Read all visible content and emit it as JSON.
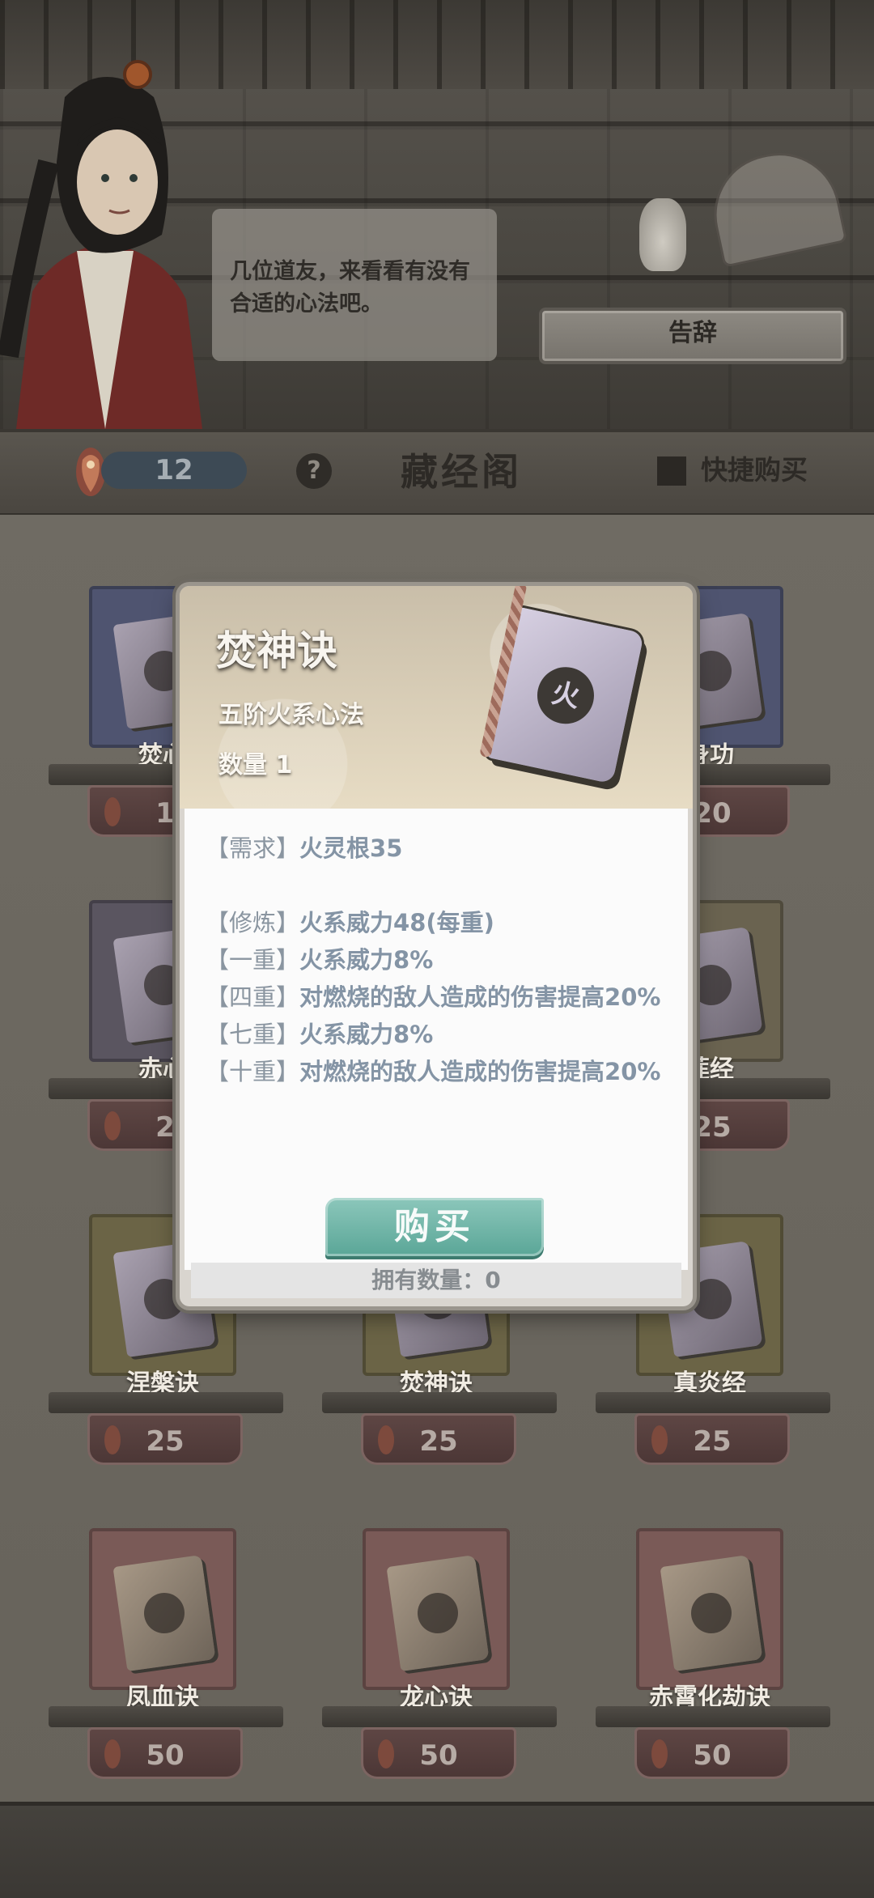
{
  "npc": {
    "speech": "几位道友，来看看有没有合适的心法吧。",
    "farewell_label": "告辞"
  },
  "header": {
    "currency_count": "12",
    "help_label": "?",
    "title": "藏经阁",
    "quick_buy_label": "快捷购买"
  },
  "shelf": {
    "rows": [
      {
        "items": [
          {
            "name": "焚心",
            "price": "1"
          },
          {
            "name": "",
            "price": ""
          },
          {
            "name": "身功",
            "price": "20"
          }
        ]
      },
      {
        "items": [
          {
            "name": "赤心",
            "price": "2"
          },
          {
            "name": "",
            "price": ""
          },
          {
            "name": "莲经",
            "price": "25"
          }
        ]
      },
      {
        "items": [
          {
            "name": "涅槃诀",
            "price": "25"
          },
          {
            "name": "焚神诀",
            "price": "25"
          },
          {
            "name": "真炎经",
            "price": "25"
          }
        ]
      },
      {
        "items": [
          {
            "name": "凤血诀",
            "price": "50"
          },
          {
            "name": "龙心诀",
            "price": "50"
          },
          {
            "name": "赤霄化劫诀",
            "price": "50"
          }
        ]
      }
    ]
  },
  "modal": {
    "skill_name": "焚神诀",
    "skill_type": "五阶火系心法",
    "quantity": "数量 1",
    "book_glyph": "火",
    "description_lines": [
      {
        "tag": "【需求】",
        "text": "火灵根35"
      },
      {
        "tag": "",
        "text": ""
      },
      {
        "tag": "【修炼】",
        "text": "火系威力48(每重)"
      },
      {
        "tag": "【一重】",
        "text": "火系威力8%"
      },
      {
        "tag": "【四重】",
        "text": "对燃烧的敌人造成的伤害提高20%"
      },
      {
        "tag": "【七重】",
        "text": "火系威力8%"
      },
      {
        "tag": "【十重】",
        "text": "对燃烧的敌人造成的伤害提高20%"
      }
    ],
    "buy_label": "购买",
    "owned_text": "拥有数量：0"
  },
  "colors": {
    "buy_button": "#5aa697",
    "description_text": "#8494a5",
    "price_tag": "#4c3736"
  }
}
